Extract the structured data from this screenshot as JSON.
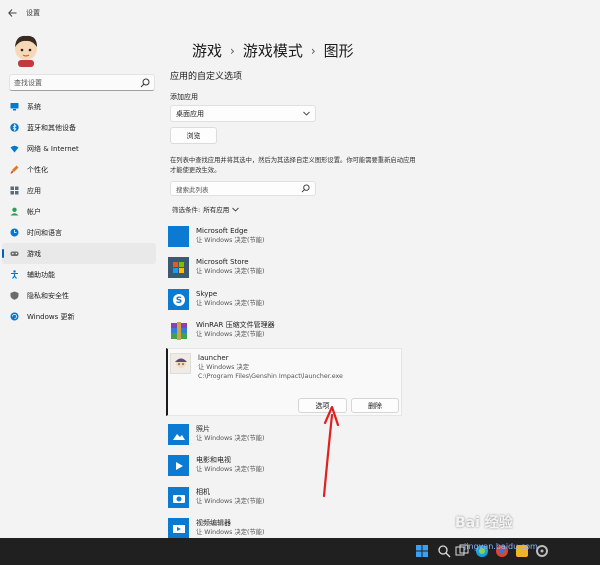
{
  "window": {
    "title": "设置",
    "back_icon": "back-arrow-icon"
  },
  "sidebar": {
    "search_placeholder": "查找设置",
    "items": [
      {
        "label": "系统",
        "icon": "monitor-icon",
        "color": "#0078d4"
      },
      {
        "label": "蓝牙和其他设备",
        "icon": "bluetooth-icon",
        "color": "#0078d4"
      },
      {
        "label": "网络 & Internet",
        "icon": "wifi-icon",
        "color": "#0078d4"
      },
      {
        "label": "个性化",
        "icon": "brush-icon",
        "color": "#e07a1f"
      },
      {
        "label": "应用",
        "icon": "apps-icon",
        "color": "#5a6b7a"
      },
      {
        "label": "帐户",
        "icon": "person-icon",
        "color": "#2f9e5a"
      },
      {
        "label": "时间和语言",
        "icon": "globe-clock-icon",
        "color": "#0078d4"
      },
      {
        "label": "游戏",
        "icon": "gamepad-icon",
        "color": "#6b6b6b",
        "active": true
      },
      {
        "label": "辅助功能",
        "icon": "accessibility-icon",
        "color": "#0078d4"
      },
      {
        "label": "隐私和安全性",
        "icon": "shield-icon",
        "color": "#6b6b6b"
      },
      {
        "label": "Windows 更新",
        "icon": "update-icon",
        "color": "#0078d4"
      }
    ]
  },
  "breadcrumb": {
    "part1": "游戏",
    "part2": "游戏模式",
    "part3": "图形",
    "sep": "›"
  },
  "main": {
    "section_title": "应用的自定义选项",
    "add_app_label": "添加应用",
    "app_type_select": "桌面应用",
    "browse_button": "浏览",
    "description": "在列表中查找应用并将其选中，然后为其选择自定义图形设置。你可能需要重新启动应用才能使更改生效。",
    "list_search_placeholder": "搜索此列表",
    "filter_label": "筛选条件:",
    "filter_value": "所有应用"
  },
  "apps": [
    {
      "name": "Microsoft Edge",
      "status": "让 Windows 决定(节能)",
      "icon": "edge-icon"
    },
    {
      "name": "Microsoft Store",
      "status": "让 Windows 决定(节能)",
      "icon": "store-icon"
    },
    {
      "name": "Skype",
      "status": "让 Windows 决定(节能)",
      "icon": "skype-icon"
    },
    {
      "name": "WinRAR 压缩文件管理器",
      "status": "让 Windows 决定(节能)",
      "icon": "winrar-icon"
    },
    {
      "name": "照片",
      "status": "让 Windows 决定(节能)",
      "icon": "photos-icon"
    },
    {
      "name": "电影和电视",
      "status": "让 Windows 决定(节能)",
      "icon": "movies-icon"
    },
    {
      "name": "相机",
      "status": "让 Windows 决定(节能)",
      "icon": "camera-icon"
    },
    {
      "name": "视频编辑器",
      "status": "让 Windows 决定(节能)",
      "icon": "video-editor-icon"
    }
  ],
  "expanded_app": {
    "name": "launcher",
    "status": "让 Windows 决定",
    "path": "C:\\Program Files\\Genshin Impact\\launcher.exe",
    "options_button": "选项",
    "delete_button": "删除"
  },
  "watermark": {
    "brand": "Bai 经验",
    "url": "jingyan.baidu.com"
  },
  "colors": {
    "accent": "#005fb8",
    "arrow": "#e02020",
    "taskbar": "#202020"
  }
}
